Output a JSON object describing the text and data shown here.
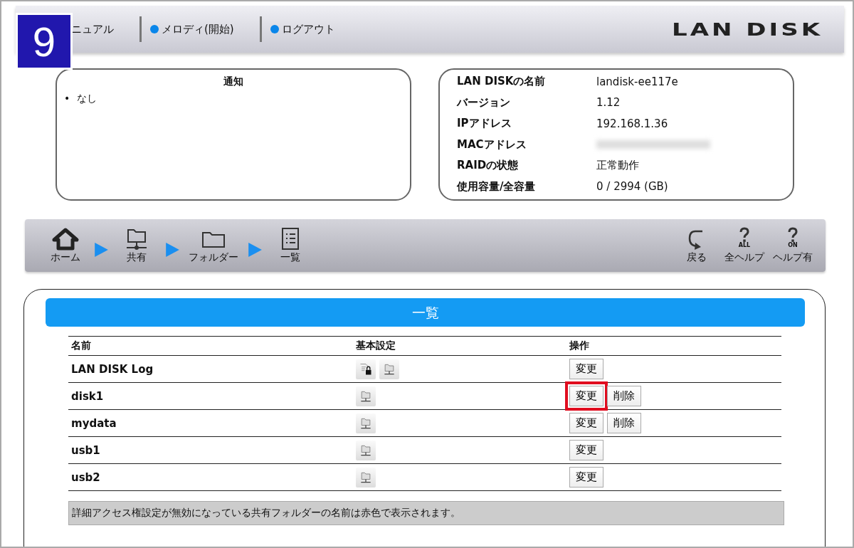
{
  "step_badge": "9",
  "header": {
    "links": [
      {
        "label": "ニュアル",
        "dot": false
      },
      {
        "label": "メロディ(開始)",
        "dot": true
      },
      {
        "label": "ログアウト",
        "dot": true
      }
    ],
    "logo": "LAN DISK"
  },
  "notice": {
    "title": "通知",
    "bullet": "•",
    "items": [
      "なし"
    ]
  },
  "info": [
    {
      "label": "LAN DISKの名前",
      "value": "landisk-ee117e"
    },
    {
      "label": "バージョン",
      "value": "1.12"
    },
    {
      "label": "IPアドレス",
      "value": "192.168.1.36"
    },
    {
      "label": "MACアドレス"
    },
    {
      "label": "RAIDの状態",
      "value": "正常動作"
    },
    {
      "label": "使用容量/全容量",
      "value": "0 / 2994 (GB)"
    }
  ],
  "toolbar": {
    "crumbs": [
      {
        "kind": "home",
        "label": "ホーム"
      },
      {
        "kind": "share",
        "label": "共有"
      },
      {
        "kind": "folder",
        "label": "フォルダー"
      },
      {
        "kind": "list",
        "label": "一覧"
      }
    ],
    "tools": [
      {
        "kind": "back",
        "label": "戻る"
      },
      {
        "kind": "help",
        "badge": "ALL",
        "label": "全ヘルプ"
      },
      {
        "kind": "help",
        "badge": "ON",
        "label": "ヘルプ有"
      }
    ]
  },
  "list": {
    "title": "一覧",
    "columns": [
      "名前",
      "基本設定",
      "操作"
    ],
    "rows": [
      {
        "name": "LAN DISK Log",
        "settings": [
          {
            "kind": "lock"
          },
          {
            "kind": "share"
          }
        ],
        "actions": [
          {
            "label": "変更",
            "highlighted": false
          }
        ]
      },
      {
        "name": "disk1",
        "settings": [
          {
            "kind": "share"
          }
        ],
        "actions": [
          {
            "label": "変更",
            "highlighted": true
          },
          {
            "label": "削除",
            "highlighted": false
          }
        ]
      },
      {
        "name": "mydata",
        "settings": [
          {
            "kind": "share"
          }
        ],
        "actions": [
          {
            "label": "変更",
            "highlighted": false
          },
          {
            "label": "削除",
            "highlighted": false
          }
        ]
      },
      {
        "name": "usb1",
        "settings": [
          {
            "kind": "share"
          }
        ],
        "actions": [
          {
            "label": "変更",
            "highlighted": false
          }
        ]
      },
      {
        "name": "usb2",
        "settings": [
          {
            "kind": "share"
          }
        ],
        "actions": [
          {
            "label": "変更",
            "highlighted": false
          }
        ]
      }
    ],
    "footnote": "詳細アクセス権設定が無効になっている共有フォルダーの名前は赤色で表示されます。"
  }
}
